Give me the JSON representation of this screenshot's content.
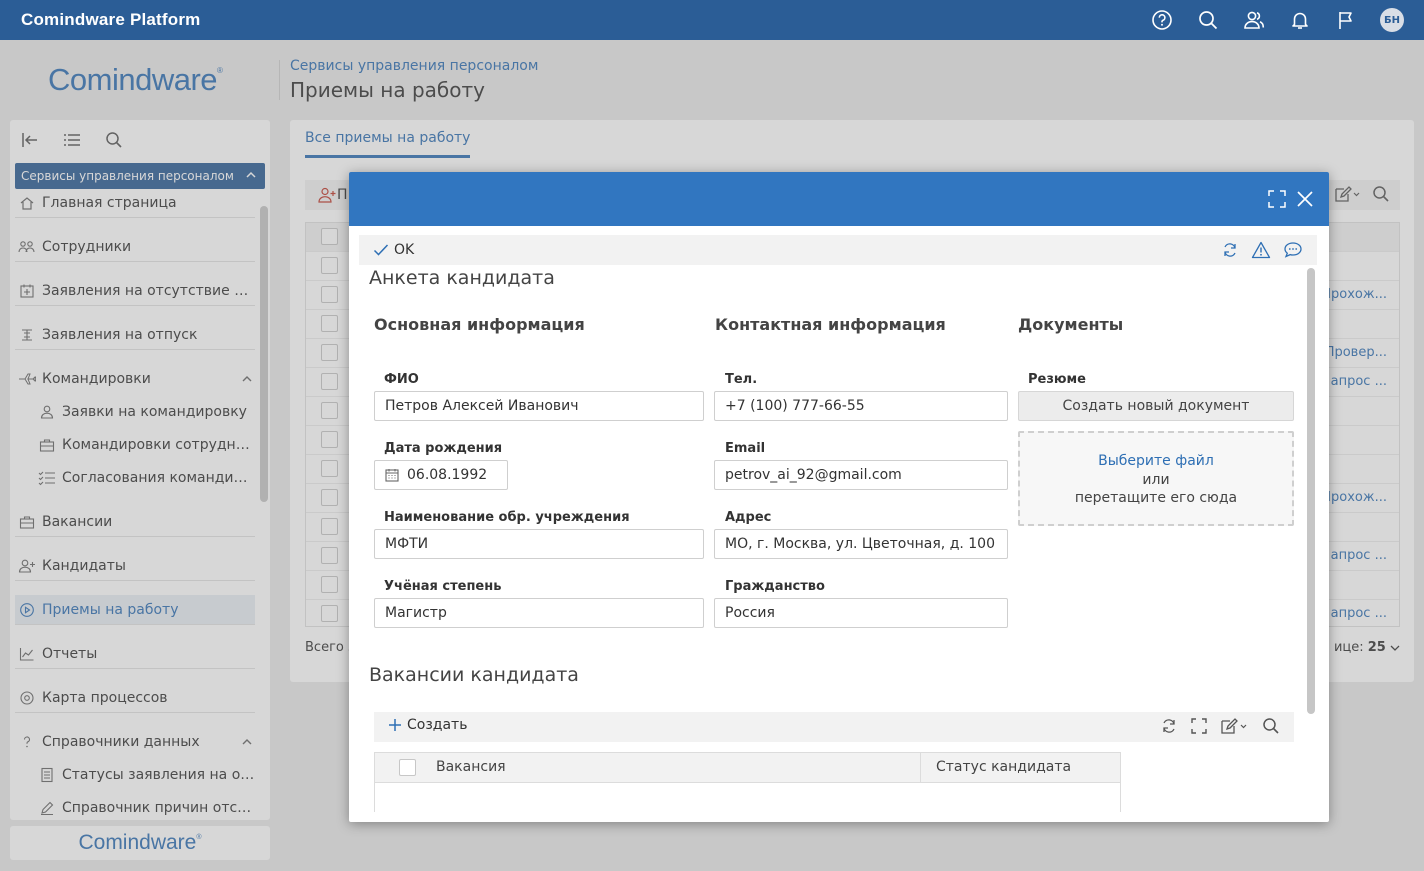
{
  "app": {
    "title": "Comindware Platform",
    "avatar_initials": "БН",
    "brand_color": "#2b5d96",
    "accent_color": "#2e6fb4",
    "top_icons": [
      "help-icon",
      "search-icon",
      "users-icon",
      "bell-icon",
      "flag-icon"
    ]
  },
  "header": {
    "logo": "Comindware",
    "logo_mark": "®",
    "breadcrumb": "Сервисы управления персоналом",
    "title": "Приемы на работу"
  },
  "sidebar": {
    "section": "Сервисы управления персоналом",
    "items": [
      {
        "label": "Главная страница",
        "icon": "home-icon"
      },
      {
        "label": "Сотрудники",
        "icon": "employees-icon"
      },
      {
        "label": "Заявления на отсутствие по ...",
        "icon": "calendar-plus-icon"
      },
      {
        "label": "Заявления на отпуск",
        "icon": "vacation-icon"
      },
      {
        "label": "Командировки",
        "icon": "plane-icon"
      },
      {
        "label": "Заявки на командировку",
        "icon": "person-icon"
      },
      {
        "label": "Командировки сотрудник...",
        "icon": "briefcase-icon"
      },
      {
        "label": "Согласования командиро...",
        "icon": "list-check-icon"
      },
      {
        "label": "Вакансии",
        "icon": "briefcase-icon"
      },
      {
        "label": "Кандидаты",
        "icon": "person-add-icon"
      },
      {
        "label": "Приемы на работу",
        "icon": "play-circle-icon"
      },
      {
        "label": "Отчеты",
        "icon": "chart-icon"
      },
      {
        "label": "Карта процессов",
        "icon": "target-icon"
      },
      {
        "label": "Справочники данных",
        "icon": "question-icon"
      },
      {
        "label": "Статусы заявления на отс...",
        "icon": "document-icon"
      },
      {
        "label": "Справочник причин отсу...",
        "icon": "pencil-icon"
      }
    ],
    "footer_logo": "Comindware",
    "footer_logo_mark": "®"
  },
  "list": {
    "tab": "Все приемы на работу",
    "add_label": "П",
    "row_links": [
      "",
      "Прохож...",
      "",
      "Провер...",
      "апрос ...",
      "",
      "",
      "",
      "Прохож...",
      "",
      "апрос ...",
      "",
      "апрос ..."
    ],
    "total_label": "Всего з",
    "page_size_label": "ице:",
    "page_size": "25"
  },
  "modal": {
    "ok_label": "OK",
    "form_title": "Анкета кандидата",
    "columns": {
      "main": "Основная информация",
      "contact": "Контактная информация",
      "docs": "Документы"
    },
    "fields": {
      "fio_label": "ФИО",
      "fio_value": "Петров Алексей Иванович",
      "birth_label": "Дата рождения",
      "birth_value": "06.08.1992",
      "edu_label": "Наименование обр. учреждения",
      "edu_value": "МФТИ",
      "degree_label": "Учёная степень",
      "degree_value": "Магистр",
      "phone_label": "Тел.",
      "phone_value": "+7 (100) 777-66-55",
      "email_label": "Email",
      "email_value": "petrov_ai_92@gmail.com",
      "address_label": "Адрес",
      "address_value": "МО, г. Москва, ул. Цветочная, д. 100",
      "citizenship_label": "Гражданство",
      "citizenship_value": "Россия",
      "resume_label": "Резюме",
      "create_doc_label": "Создать новый документ",
      "pick_file_label": "Выберите файл",
      "or_label": "или",
      "drag_label": "перетащите его сюда"
    },
    "vacancies": {
      "title": "Вакансии кандидата",
      "create_label": "Создать",
      "col_vacancy": "Вакансия",
      "col_status": "Статус кандидата"
    }
  }
}
